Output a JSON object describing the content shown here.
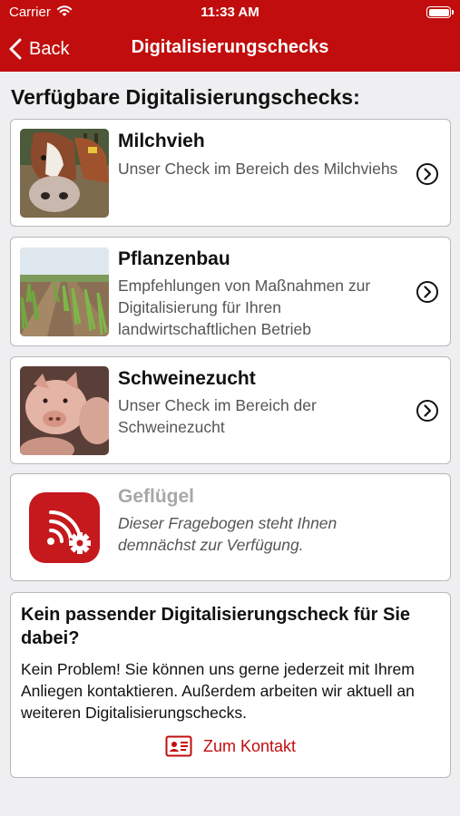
{
  "status_bar": {
    "carrier": "Carrier",
    "time": "11:33 AM"
  },
  "nav": {
    "back_label": "Back",
    "title": "Digitalisierungschecks"
  },
  "section_heading": "Verfügbare Digitalisierungschecks:",
  "checks": [
    {
      "title": "Milchvieh",
      "description": "Unser Check im Bereich des Milchviehs",
      "image": "cow-photo",
      "available": true
    },
    {
      "title": "Pflanzenbau",
      "description": "Empfehlungen von Maßnahmen zur Digitalisierung für Ihren landwirtschaftlichen Betrieb",
      "image": "crop-field-photo",
      "available": true
    },
    {
      "title": "Schweinezucht",
      "description": "Unser Check im Bereich der Schweinezucht",
      "image": "pigs-photo",
      "available": true
    },
    {
      "title": "Geflügel",
      "description": "Dieser Fragebogen steht Ihnen demnächst zur Verfügung.",
      "image": "digital-settings-icon",
      "available": false
    }
  ],
  "info": {
    "title": "Kein passender Digitalisierungscheck für Sie dabei?",
    "body": "Kein Problem! Sie können uns gerne jederzeit mit Ihrem Anliegen kontaktieren. Außerdem arbeiten wir aktuell an weiteren Digitalisierungschecks.",
    "contact_label": "Zum Kontakt"
  },
  "colors": {
    "brand_red": "#c10d0d",
    "background": "#efeff1"
  }
}
